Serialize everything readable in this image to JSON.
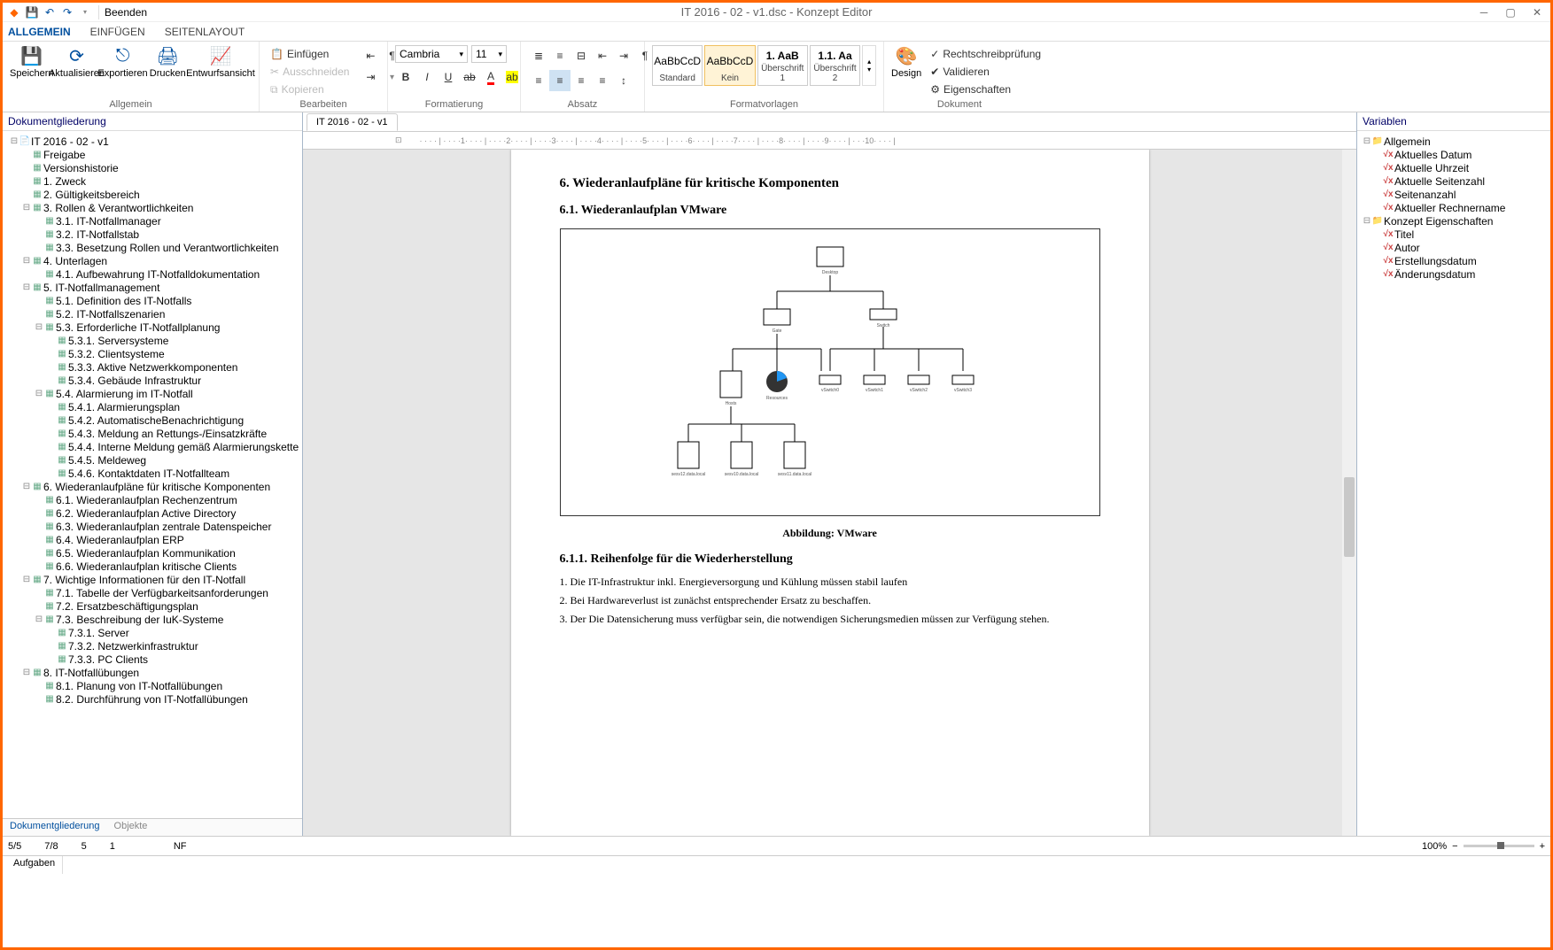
{
  "titlebar": {
    "exit_label": "Beenden",
    "title": "IT 2016 - 02 - v1.dsc - Konzept Editor"
  },
  "ribbon_tabs": [
    "ALLGEMEIN",
    "EINFÜGEN",
    "SEITENLAYOUT"
  ],
  "groups": {
    "allgemein": {
      "name": "Allgemein",
      "save": "Speichern",
      "refresh": "Aktualisieren",
      "export": "Exportieren",
      "print": "Drucken",
      "draft": "Entwurfsansicht"
    },
    "bearbeiten": {
      "name": "Bearbeiten",
      "paste": "Einfügen",
      "cut": "Ausschneiden",
      "copy": "Kopieren"
    },
    "format": {
      "name": "Formatierung",
      "font": "Cambria",
      "size": "11"
    },
    "absatz": {
      "name": "Absatz"
    },
    "styles": {
      "name": "Formatvorlagen",
      "items": [
        {
          "sample": "AaBbCcD",
          "name": "Standard"
        },
        {
          "sample": "AaBbCcD",
          "name": "Kein"
        },
        {
          "sample": "1. AaB",
          "name": "Überschrift 1"
        },
        {
          "sample": "1.1. Aa",
          "name": "Überschrift 2"
        }
      ]
    },
    "dokument": {
      "name": "Dokument",
      "design": "Design",
      "spell": "Rechtschreibprüfung",
      "validate": "Validieren",
      "props": "Eigenschaften"
    }
  },
  "left_panel": {
    "title": "Dokumentgliederung",
    "tabs": [
      "Dokumentgliederung",
      "Objekte"
    ],
    "tree": [
      {
        "d": 0,
        "t": "p",
        "l": "IT 2016 - 02 - v1",
        "e": "-"
      },
      {
        "d": 1,
        "t": "s",
        "l": "Freigabe"
      },
      {
        "d": 1,
        "t": "s",
        "l": "Versionshistorie"
      },
      {
        "d": 1,
        "t": "s",
        "l": "1. Zweck"
      },
      {
        "d": 1,
        "t": "s",
        "l": "2. Gültigkeitsbereich"
      },
      {
        "d": 1,
        "t": "s",
        "l": "3. Rollen & Verantwortlichkeiten",
        "e": "-"
      },
      {
        "d": 2,
        "t": "s",
        "l": "3.1. IT-Notfallmanager"
      },
      {
        "d": 2,
        "t": "s",
        "l": "3.2. IT-Notfallstab"
      },
      {
        "d": 2,
        "t": "s",
        "l": "3.3. Besetzung Rollen und Verantwortlichkeiten"
      },
      {
        "d": 1,
        "t": "s",
        "l": "4. Unterlagen",
        "e": "-"
      },
      {
        "d": 2,
        "t": "s",
        "l": "4.1. Aufbewahrung IT-Notfalldokumentation"
      },
      {
        "d": 1,
        "t": "s",
        "l": "5. IT-Notfallmanagement",
        "e": "-"
      },
      {
        "d": 2,
        "t": "s",
        "l": "5.1. Definition des IT-Notfalls"
      },
      {
        "d": 2,
        "t": "s",
        "l": "5.2. IT-Notfallszenarien"
      },
      {
        "d": 2,
        "t": "s",
        "l": "5.3. Erforderliche IT-Notfallplanung",
        "e": "-"
      },
      {
        "d": 3,
        "t": "s",
        "l": "5.3.1. Serversysteme"
      },
      {
        "d": 3,
        "t": "s",
        "l": "5.3.2. Clientsysteme"
      },
      {
        "d": 3,
        "t": "s",
        "l": "5.3.3. Aktive Netzwerkkomponenten"
      },
      {
        "d": 3,
        "t": "s",
        "l": "5.3.4. Gebäude Infrastruktur"
      },
      {
        "d": 2,
        "t": "s",
        "l": "5.4. Alarmierung im IT-Notfall",
        "e": "-"
      },
      {
        "d": 3,
        "t": "s",
        "l": "5.4.1. Alarmierungsplan"
      },
      {
        "d": 3,
        "t": "s",
        "l": "5.4.2. AutomatischeBenachrichtigung"
      },
      {
        "d": 3,
        "t": "s",
        "l": "5.4.3. Meldung an Rettungs-/Einsatzkräfte"
      },
      {
        "d": 3,
        "t": "s",
        "l": "5.4.4. Interne Meldung gemäß Alarmierungskette"
      },
      {
        "d": 3,
        "t": "s",
        "l": "5.4.5. Meldeweg"
      },
      {
        "d": 3,
        "t": "s",
        "l": "5.4.6. Kontaktdaten IT-Notfallteam"
      },
      {
        "d": 1,
        "t": "s",
        "l": "6. Wiederanlaufpläne für kritische Komponenten",
        "e": "-"
      },
      {
        "d": 2,
        "t": "s",
        "l": "6.1. Wiederanlaufplan Rechenzentrum"
      },
      {
        "d": 2,
        "t": "s",
        "l": "6.2. Wiederanlaufplan Active Directory"
      },
      {
        "d": 2,
        "t": "s",
        "l": "6.3. Wiederanlaufplan zentrale Datenspeicher"
      },
      {
        "d": 2,
        "t": "s",
        "l": "6.4. Wiederanlaufplan ERP"
      },
      {
        "d": 2,
        "t": "s",
        "l": "6.5. Wiederanlaufplan Kommunikation"
      },
      {
        "d": 2,
        "t": "s",
        "l": "6.6. Wiederanlaufplan kritische Clients"
      },
      {
        "d": 1,
        "t": "s",
        "l": "7. Wichtige Informationen für den IT-Notfall",
        "e": "-"
      },
      {
        "d": 2,
        "t": "s",
        "l": "7.1. Tabelle der Verfügbarkeitsanforderungen"
      },
      {
        "d": 2,
        "t": "s",
        "l": "7.2. Ersatzbeschäftigungsplan"
      },
      {
        "d": 2,
        "t": "s",
        "l": "7.3. Beschreibung der IuK-Systeme",
        "e": "-"
      },
      {
        "d": 3,
        "t": "s",
        "l": "7.3.1. Server"
      },
      {
        "d": 3,
        "t": "s",
        "l": "7.3.2. Netzwerkinfrastruktur"
      },
      {
        "d": 3,
        "t": "s",
        "l": "7.3.3. PC Clients"
      },
      {
        "d": 1,
        "t": "s",
        "l": "8. IT-Notfallübungen",
        "e": "-"
      },
      {
        "d": 2,
        "t": "s",
        "l": "8.1. Planung von IT-Notfallübungen"
      },
      {
        "d": 2,
        "t": "s",
        "l": "8.2. Durchführung von IT-Notfallübungen"
      }
    ]
  },
  "right_panel": {
    "title": "Variablen",
    "groups": [
      {
        "name": "Allgemein",
        "items": [
          "Aktuelles Datum",
          "Aktuelle Uhrzeit",
          "Aktuelle Seitenzahl",
          "Seitenanzahl",
          "Aktueller Rechnername"
        ]
      },
      {
        "name": "Konzept Eigenschaften",
        "items": [
          "Titel",
          "Autor",
          "Erstellungsdatum",
          "Änderungsdatum"
        ]
      }
    ]
  },
  "doc_tab": "IT 2016 - 02 - v1",
  "page_content": {
    "h1": "6. Wiederanlaufpläne für kritische Komponenten",
    "h2": "6.1. Wiederanlaufplan VMware",
    "figcap": "Abbildung: VMware",
    "h3": "6.1.1. Reihenfolge für die Wiederherstellung",
    "p1": "1. Die IT-Infrastruktur inkl. Energieversorgung und Kühlung müssen stabil laufen",
    "p2": "2. Bei Hardwareverlust ist zunächst entsprechender Ersatz zu beschaffen.",
    "p3": "3. Der Die Datensicherung muss verfügbar sein, die notwendigen Sicherungsmedien müssen zur Verfügung stehen.",
    "diagram": {
      "root": "Desktop",
      "l2": [
        "Gate",
        "Switch"
      ],
      "l3_left": [
        "Hosts",
        "Resources"
      ],
      "l3_right": [
        "vSwitch0",
        "vSwitch1",
        "vSwitch2",
        "vSwitch3"
      ],
      "l4": [
        "sesv12.data.local",
        "sesv10.data.local",
        "sesv11.data.local"
      ]
    }
  },
  "statusbar": {
    "s1": "5/5",
    "s2": "7/8",
    "s3": "5",
    "s4": "1",
    "s5": "NF",
    "zoom": "100%"
  },
  "bottom_tab": "Aufgaben"
}
